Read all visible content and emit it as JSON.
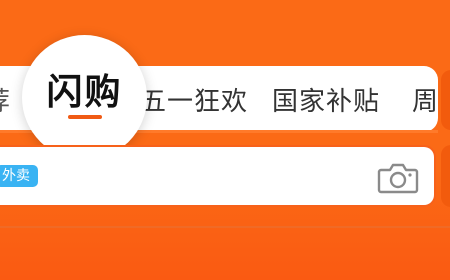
{
  "tabs": {
    "active": "闪购",
    "recommend_partial": "荐",
    "wuyi": "五一狂欢",
    "subsidy": "国家补贴",
    "next_partial": "周"
  },
  "search": {
    "badge": "外卖",
    "camera_icon": "camera-icon"
  },
  "colors": {
    "accent": "#fb6a16",
    "badge": "#39b3f3"
  }
}
